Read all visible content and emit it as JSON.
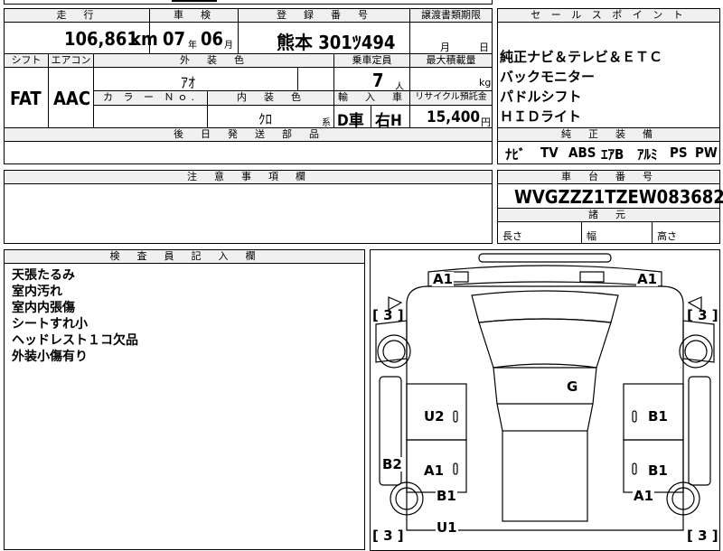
{
  "header": {
    "mileage_label": "走　行",
    "shaken_label": "車　検",
    "reg_label": "登　録　番　号",
    "transfer_label": "譲渡書類期限",
    "mileage_value": "106,861",
    "mileage_unit": "km",
    "shaken_year": "07",
    "shaken_year_unit": "年",
    "shaken_month": "06",
    "shaken_month_unit": "月",
    "reg_number": "熊本 301ﾂ494",
    "transfer_month_unit": "月",
    "transfer_day_unit": "日"
  },
  "specs": {
    "shift_label": "シフト",
    "aircon_label": "エアコン",
    "exterior_label": "外　装　色",
    "capacity_label": "乗車定員",
    "maxload_label": "最大積載量",
    "shift_value": "FAT",
    "aircon_value": "AAC",
    "exterior_value": "ｱｵ",
    "capacity_value": "7",
    "capacity_unit": "人",
    "maxload_unit": "kg",
    "colorno_label": "カ ラ ー Ｎｏ.",
    "interior_label": "内　装　色",
    "import_label": "輸　入　車",
    "recycle_label": "リサイクル預託金",
    "interior_value": "ｸﾛ",
    "interior_suffix": "系",
    "import_value": "D車",
    "handle_value": "右H",
    "recycle_value": "15,400",
    "recycle_unit": "円",
    "later_parts_label": "後　日　発　送　部　品"
  },
  "sales_points": {
    "label": "セ ー ル ス ポ イ ン ト",
    "items": [
      "純正ナビ＆テレビ＆ＥＴＣ",
      "バックモニター",
      "パドルシフト",
      "ＨＩＤライト"
    ]
  },
  "equipment": {
    "label": "純　正　装　備",
    "items": [
      "ﾅﾋﾞ",
      "TV",
      "ABS",
      "ｴｱB",
      "ｱﾙﾐ",
      "PS",
      "PW"
    ]
  },
  "notes": {
    "label": "注　意　事　項　欄"
  },
  "chassis": {
    "label": "車　台　番　号",
    "value": "WVGZZZ1TZEW083682"
  },
  "dimensions": {
    "label": "諸　元",
    "length_label": "長さ",
    "width_label": "幅",
    "height_label": "高さ"
  },
  "inspector": {
    "label": "検　査　員　記　入　欄",
    "remarks": [
      "天張たるみ",
      "室内汚れ",
      "室内内張傷",
      "シートすれ小",
      "ヘッドレスト１コ欠品",
      "外装小傷有り"
    ]
  },
  "diagram": {
    "marks": {
      "front_left": "A1",
      "front_right": "A1",
      "roof": "G",
      "left_front_door": "U2",
      "right_front_door": "B1",
      "left_rear_fender": "B2",
      "left_rear_door": "A1",
      "right_rear_door": "B1",
      "left_rear_wheel_area": "B1",
      "right_rear_wheel_area": "A1",
      "rear_left": "U1"
    },
    "tires": {
      "front_left": "3",
      "front_right": "3",
      "rear_left": "3",
      "rear_right": "3"
    }
  }
}
